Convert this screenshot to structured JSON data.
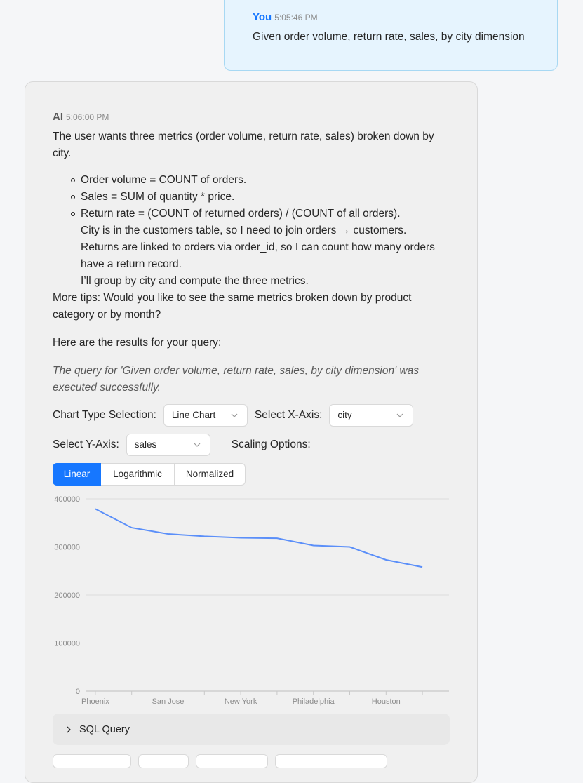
{
  "user_message": {
    "sender": "You",
    "time": "5:05:46 PM",
    "text": "Given order volume, return rate, sales, by city dimension"
  },
  "ai_message": {
    "sender": "AI",
    "time": "5:06:00 PM",
    "intro": "The user wants three metrics (order volume, return rate, sales) broken down by city.",
    "bullets": [
      "Order volume = COUNT of orders.",
      "Sales = SUM of quantity * price.",
      "Return rate = (COUNT of returned orders) / (COUNT of all orders)."
    ],
    "continuation": [
      "City is in the customers table, so I need to join orders → customers.",
      "Returns are linked to orders via order_id, so I can count how many orders have a return record.",
      "I’ll group by city and compute the three metrics."
    ],
    "tips": "More tips: Would you like to see the same metrics broken down by product category or by month?",
    "results_heading": "Here are the results for your query:",
    "success_note": "The query for 'Given order volume, return rate, sales, by city dimension' was executed successfully."
  },
  "controls": {
    "chart_type_label": "Chart Type Selection:",
    "chart_type_value": "Line Chart",
    "x_axis_label": "Select X-Axis:",
    "x_axis_value": "city",
    "y_axis_label": "Select Y-Axis:",
    "y_axis_value": "sales",
    "scaling_label": "Scaling Options:",
    "scaling_options": [
      "Linear",
      "Logarithmic",
      "Normalized"
    ],
    "scaling_selected": "Linear"
  },
  "chart_data": {
    "type": "line",
    "x": [
      "Phoenix",
      "",
      "San Jose",
      "",
      "New York",
      "",
      "Philadelphia",
      "",
      "Houston",
      ""
    ],
    "tick_labels_shown": [
      "Phoenix",
      "San Jose",
      "New York",
      "Philadelphia",
      "Houston"
    ],
    "series": [
      {
        "values": [
          379000,
          340000,
          327000,
          322000,
          319000,
          318000,
          303000,
          300000,
          273000,
          258000
        ]
      }
    ],
    "ylim": [
      0,
      400000
    ],
    "yticks": [
      "0",
      "100000",
      "200000",
      "300000",
      "400000"
    ],
    "grid": true,
    "line_color": "#5b8ff9"
  },
  "sql_panel": {
    "label": "SQL Query"
  }
}
